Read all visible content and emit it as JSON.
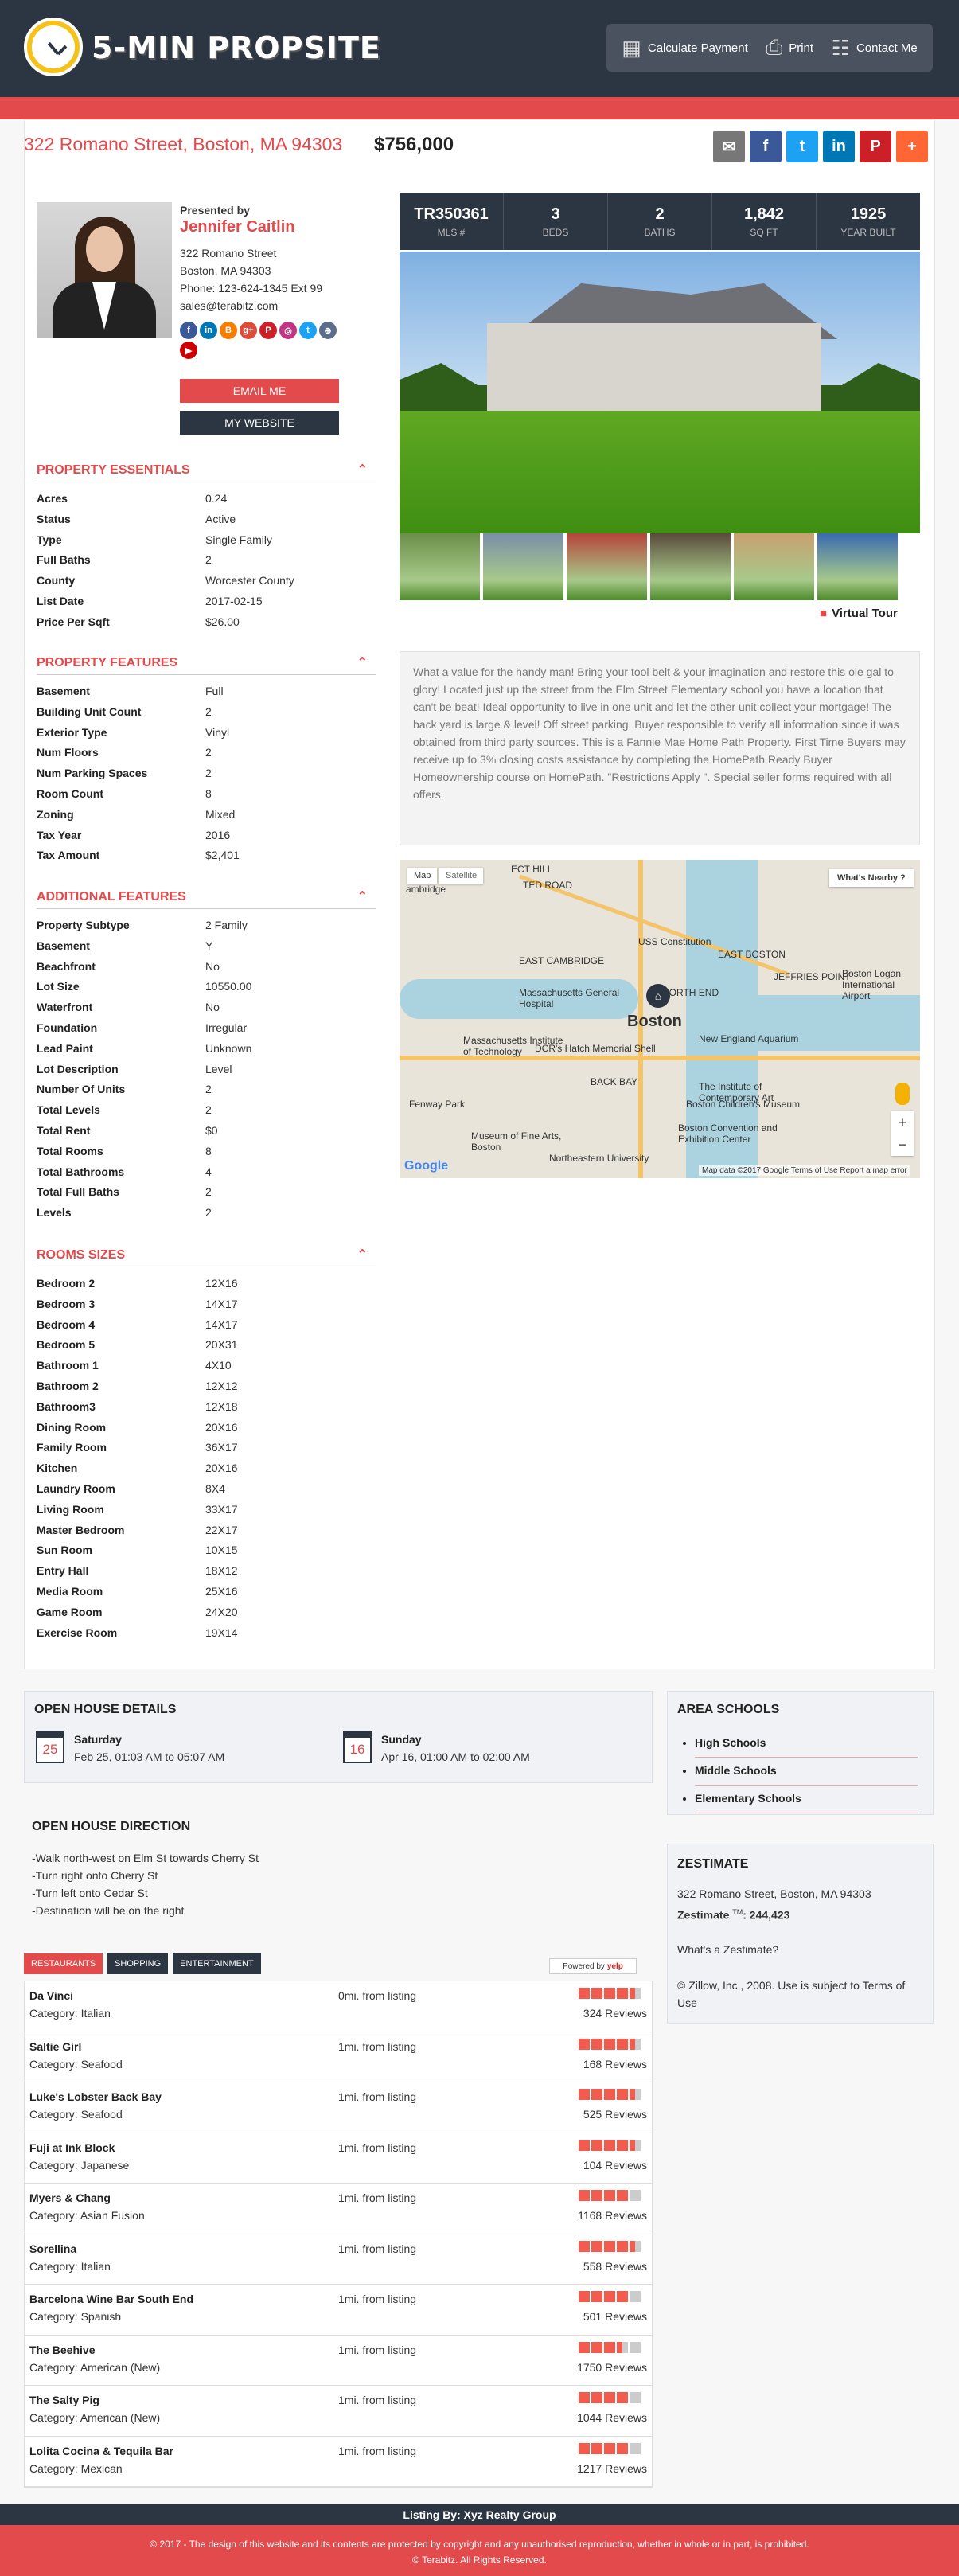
{
  "header": {
    "logo_text": "5-MIN PROPSITE",
    "nav": [
      {
        "icon": "calculator-icon",
        "glyph": "▦",
        "label": "Calculate Payment"
      },
      {
        "icon": "printer-icon",
        "glyph": "⎙",
        "label": "Print"
      },
      {
        "icon": "contact-card-icon",
        "glyph": "☷",
        "label": "Contact Me"
      }
    ]
  },
  "listing": {
    "address": "322 Romano Street, Boston, MA 94303",
    "price": "$756,000",
    "share": [
      {
        "icon": "email-icon",
        "glyph": "✉",
        "color": "#777777"
      },
      {
        "icon": "facebook-icon",
        "glyph": "f",
        "color": "#3b5998"
      },
      {
        "icon": "twitter-icon",
        "glyph": "t",
        "color": "#1da1f2"
      },
      {
        "icon": "linkedin-icon",
        "glyph": "in",
        "color": "#0077b5"
      },
      {
        "icon": "pinterest-icon",
        "glyph": "P",
        "color": "#cb2027"
      },
      {
        "icon": "more-share-icon",
        "glyph": "+",
        "color": "#ff6633"
      }
    ]
  },
  "agent": {
    "presented_by": "Presented by",
    "name": "Jennifer Caitlin",
    "street": "322 Romano Street",
    "city": "Boston, MA 94303",
    "phone": "Phone: 123-624-1345 Ext 99",
    "email": "sales@terabitz.com",
    "social": [
      {
        "icon": "facebook-icon",
        "glyph": "f",
        "color": "#3b5998"
      },
      {
        "icon": "linkedin-icon",
        "glyph": "in",
        "color": "#0077b5"
      },
      {
        "icon": "blogger-icon",
        "glyph": "B",
        "color": "#f57d00"
      },
      {
        "icon": "google-plus-icon",
        "glyph": "g+",
        "color": "#dd4b39"
      },
      {
        "icon": "pinterest-icon",
        "glyph": "P",
        "color": "#cb2027"
      },
      {
        "icon": "instagram-icon",
        "glyph": "◎",
        "color": "#c13584"
      },
      {
        "icon": "twitter-icon",
        "glyph": "t",
        "color": "#1da1f2"
      },
      {
        "icon": "website-icon",
        "glyph": "⊕",
        "color": "#5a6e8c"
      },
      {
        "icon": "youtube-icon",
        "glyph": "▶",
        "color": "#cc0000"
      }
    ],
    "email_button": "EMAIL ME",
    "website_button": "MY WEBSITE"
  },
  "sections": [
    {
      "title": "PROPERTY ESSENTIALS",
      "rows": [
        [
          "Acres",
          "0.24"
        ],
        [
          "Status",
          "Active"
        ],
        [
          "Type",
          "Single Family"
        ],
        [
          "Full Baths",
          "2"
        ],
        [
          "County",
          "Worcester County"
        ],
        [
          "List Date",
          "2017-02-15"
        ],
        [
          "Price Per Sqft",
          "$26.00"
        ]
      ]
    },
    {
      "title": "PROPERTY FEATURES",
      "rows": [
        [
          "Basement",
          "Full"
        ],
        [
          "Building Unit Count",
          "2"
        ],
        [
          "Exterior Type",
          "Vinyl"
        ],
        [
          "Num Floors",
          "2"
        ],
        [
          "Num Parking Spaces",
          "2"
        ],
        [
          "Room Count",
          "8"
        ],
        [
          "Zoning",
          "Mixed"
        ],
        [
          "Tax Year",
          "2016"
        ],
        [
          "Tax Amount",
          "$2,401"
        ]
      ]
    },
    {
      "title": "ADDITIONAL FEATURES",
      "rows": [
        [
          "Property Subtype",
          "2 Family"
        ],
        [
          "Basement",
          "Y"
        ],
        [
          "Beachfront",
          "No"
        ],
        [
          "Lot Size",
          "10550.00"
        ],
        [
          "Waterfront",
          "No"
        ],
        [
          "Foundation",
          "Irregular"
        ],
        [
          "Lead Paint",
          "Unknown"
        ],
        [
          "Lot Description",
          "Level"
        ],
        [
          "Number Of Units",
          "2"
        ],
        [
          "Total Levels",
          "2"
        ],
        [
          "Total Rent",
          "$0"
        ],
        [
          "Total Rooms",
          "8"
        ],
        [
          "Total Bathrooms",
          "4"
        ],
        [
          "Total Full Baths",
          "2"
        ],
        [
          "Levels",
          "2"
        ]
      ]
    },
    {
      "title": "ROOMS SIZES",
      "rows": [
        [
          "Bedroom 2",
          "12X16"
        ],
        [
          "Bedroom 3",
          "14X17"
        ],
        [
          "Bedroom 4",
          "14X17"
        ],
        [
          "Bedroom 5",
          "20X31"
        ],
        [
          "Bathroom 1",
          "4X10"
        ],
        [
          "Bathroom 2",
          "12X12"
        ],
        [
          "Bathroom3",
          "12X18"
        ],
        [
          "Dining Room",
          "20X16"
        ],
        [
          "Family Room",
          "36X17"
        ],
        [
          "Kitchen",
          "20X16"
        ],
        [
          "Laundry Room",
          "8X4"
        ],
        [
          "Living Room",
          "33X17"
        ],
        [
          "Master Bedroom",
          "22X17"
        ],
        [
          "Sun Room",
          "10X15"
        ],
        [
          "Entry Hall",
          "18X12"
        ],
        [
          "Media Room",
          "25X16"
        ],
        [
          "Game Room",
          "24X20"
        ],
        [
          "Exercise Room",
          "19X14"
        ]
      ]
    }
  ],
  "stats": [
    {
      "num": "TR350361",
      "label": "MLS #"
    },
    {
      "num": "3",
      "label": "BEDS"
    },
    {
      "num": "2",
      "label": "BATHS"
    },
    {
      "num": "1,842",
      "label": "SQ FT"
    },
    {
      "num": "1925",
      "label": "YEAR BUILT"
    }
  ],
  "gallery": {
    "thumb_colors": [
      "#6b8f4a",
      "#7a8fa8",
      "#b5443a",
      "#5a4a3c",
      "#c8a070",
      "#3a6ab0"
    ],
    "virtual_tour": "Virtual Tour"
  },
  "description": "What a value for the handy man! Bring your tool belt & your imagination and restore this ole gal to glory! Located just up the street from the Elm Street Elementary school you have a location that can't be beat! Ideal opportunity to live in one unit and let the other unit collect your mortgage! The back yard is large & level! Off street parking. Buyer responsible to verify all information since it was obtained from third party sources. This is a Fannie Mae Home Path Property. First Time Buyers may receive up to 3% closing costs assistance by completing the HomePath Ready Buyer Homeownership course on HomePath. \"Restrictions Apply \". Special seller forms required with all offers.",
  "map": {
    "tab_map": "Map",
    "tab_satellite": "Satellite",
    "whats_nearby": "What's Nearby ?",
    "city": "Boston",
    "labels": [
      "ambridge",
      "USS Constitution",
      "EAST BOSTON",
      "JEFFRIES POINT",
      "Boston Logan International Airport",
      "EAST CAMBRIDGE",
      "Massachusetts General Hospital",
      "NORTH END",
      "Massachusetts Institute of Technology",
      "DCR's Hatch Memorial Shell",
      "New England Aquarium",
      "BACK BAY",
      "The Institute of Contemporary Art",
      "Fenway Park",
      "Boston Children's Museum",
      "Boston Convention and Exhibition Center",
      "Museum of Fine Arts, Boston",
      "Northeastern University",
      "ECT HILL",
      "TED ROAD"
    ],
    "google": "Google",
    "footer": "Map data ©2017 Google    Terms of Use    Report a map error"
  },
  "open_house": {
    "title": "OPEN HOUSE DETAILS",
    "events": [
      {
        "date": "25",
        "day": "Saturday",
        "time": "Feb 25, 01:03 AM to 05:07 AM"
      },
      {
        "date": "16",
        "day": "Sunday",
        "time": "Apr 16, 01:00 AM to 02:00 AM"
      }
    ]
  },
  "schools": {
    "title": "AREA SCHOOLS",
    "items": [
      "High Schools",
      "Middle Schools",
      "Elementary Schools"
    ]
  },
  "directions": {
    "title": "OPEN HOUSE DIRECTION",
    "lines": [
      "-Walk north-west on Elm St towards Cherry St",
      "-Turn right onto Cherry St",
      "-Turn left onto Cedar St",
      "-Destination will be on the right"
    ]
  },
  "zestimate": {
    "title": "ZESTIMATE",
    "address": "322 Romano Street, Boston, MA 94303",
    "value_label": "Zestimate",
    "tm": "TM",
    "value": ": 244,423",
    "question": "What's a Zestimate?",
    "legal": "© Zillow, Inc., 2008. Use is subject to Terms of Use"
  },
  "yelp": {
    "tabs": [
      "RESTAURANTS",
      "SHOPPING",
      "ENTERTAINMENT"
    ],
    "powered": "Powered by",
    "brand": "yelp",
    "items": [
      {
        "name": "Da Vinci",
        "category": "Category: Italian",
        "distance": "0mi. from listing",
        "rating": 4.5,
        "reviews": "324 Reviews"
      },
      {
        "name": "Saltie Girl",
        "category": "Category: Seafood",
        "distance": "1mi. from listing",
        "rating": 4.5,
        "reviews": "168 Reviews"
      },
      {
        "name": "Luke's Lobster Back Bay",
        "category": "Category: Seafood",
        "distance": "1mi. from listing",
        "rating": 4.5,
        "reviews": "525 Reviews"
      },
      {
        "name": "Fuji at Ink Block",
        "category": "Category: Japanese",
        "distance": "1mi. from listing",
        "rating": 4.5,
        "reviews": "104 Reviews"
      },
      {
        "name": "Myers & Chang",
        "category": "Category: Asian Fusion",
        "distance": "1mi. from listing",
        "rating": 4.0,
        "reviews": "1168 Reviews"
      },
      {
        "name": "Sorellina",
        "category": "Category: Italian",
        "distance": "1mi. from listing",
        "rating": 4.5,
        "reviews": "558 Reviews"
      },
      {
        "name": "Barcelona Wine Bar South End",
        "category": "Category: Spanish",
        "distance": "1mi. from listing",
        "rating": 4.0,
        "reviews": "501 Reviews"
      },
      {
        "name": "The Beehive",
        "category": "Category: American (New)",
        "distance": "1mi. from listing",
        "rating": 3.5,
        "reviews": "1750 Reviews"
      },
      {
        "name": "The Salty Pig",
        "category": "Category: American (New)",
        "distance": "1mi. from listing",
        "rating": 4.0,
        "reviews": "1044 Reviews"
      },
      {
        "name": "Lolita Cocina & Tequila Bar",
        "category": "Category: Mexican",
        "distance": "1mi. from listing",
        "rating": 4.0,
        "reviews": "1217 Reviews"
      }
    ]
  },
  "footer": {
    "listing_by": "Listing By: Xyz Realty Group",
    "copyright": "© 2017 - The design of this website and its contents are protected by copyright and any unauthorised reproduction, whether in whole or in part, is prohibited.",
    "brand": "© Terabitz. All Rights Reserved."
  }
}
